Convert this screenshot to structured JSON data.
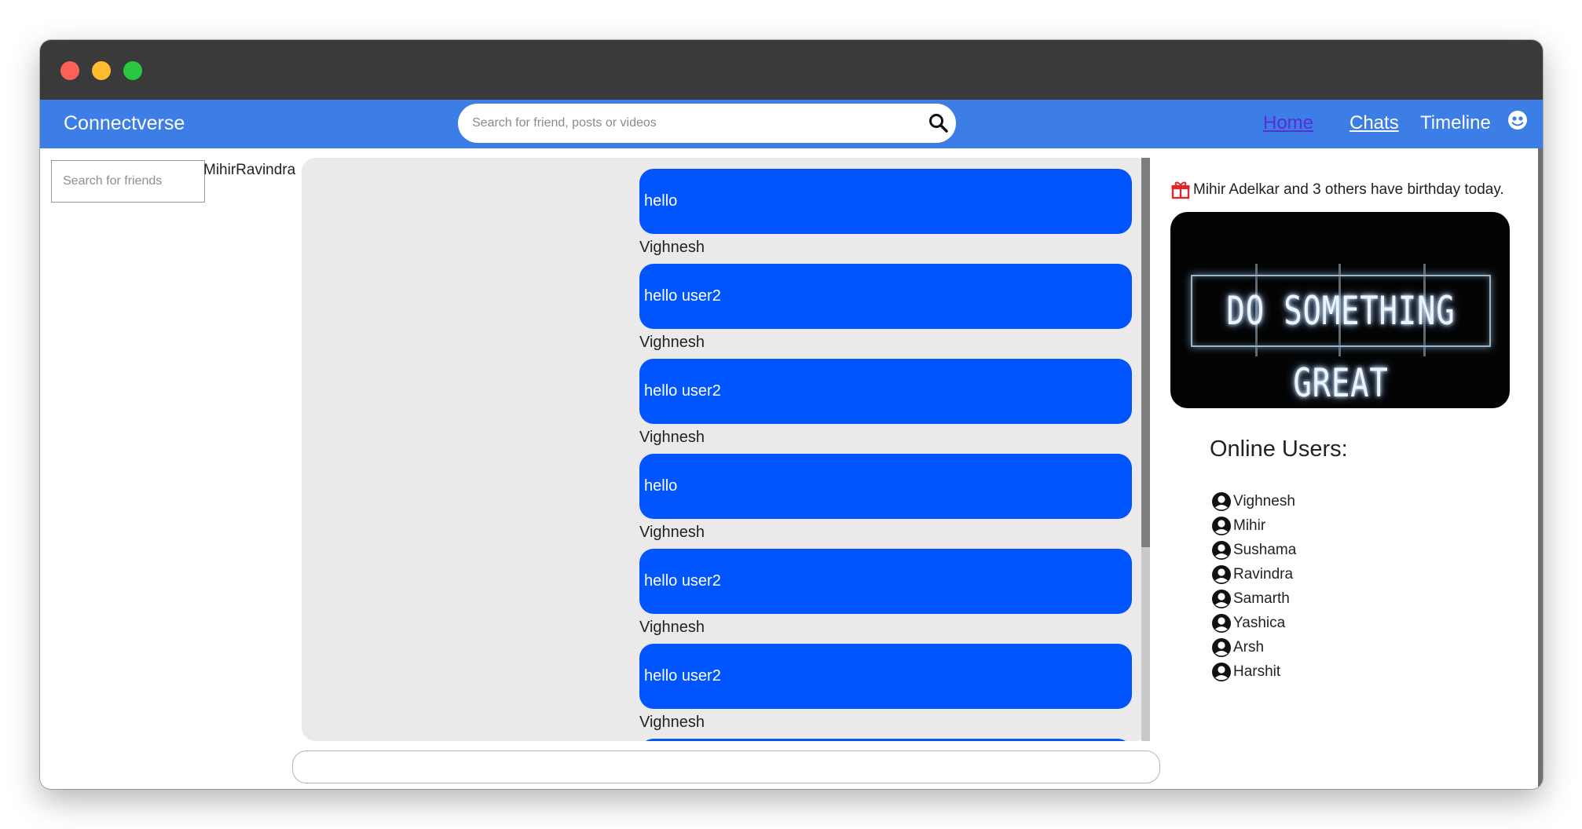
{
  "app": {
    "brand": "Connectverse"
  },
  "header": {
    "search_placeholder": "Search for friend, posts or videos",
    "nav": {
      "home": "Home",
      "chats": "Chats",
      "timeline": "Timeline"
    },
    "colors": {
      "navbar": "#3d7de6",
      "home_link": "#5a2ed6"
    }
  },
  "sidebar": {
    "friend_search_placeholder": "Search for friends",
    "friend_name": "MihirRavindra"
  },
  "chat": {
    "bubble_color": "#0055ff",
    "messages": [
      {
        "text": "hello",
        "sender": "Vighnesh"
      },
      {
        "text": "hello user2",
        "sender": "Vighnesh"
      },
      {
        "text": "hello user2",
        "sender": "Vighnesh"
      },
      {
        "text": "hello",
        "sender": "Vighnesh"
      },
      {
        "text": "hello user2",
        "sender": "Vighnesh"
      },
      {
        "text": "hello user2",
        "sender": "Vighnesh"
      }
    ]
  },
  "rightbar": {
    "birthday_text": "Mihir Adelkar and 3 others have birthday today.",
    "banner_text": "DO SOMETHING GREAT",
    "online_title": "Online Users:",
    "online_users": [
      "Vighnesh",
      "Mihir",
      "Sushama",
      "Ravindra",
      "Samarth",
      "Yashica",
      "Arsh",
      "Harshit"
    ]
  },
  "icons": {
    "search": "search-icon",
    "profile": "profile-icon",
    "gift": "gift-icon",
    "user": "user-icon"
  }
}
